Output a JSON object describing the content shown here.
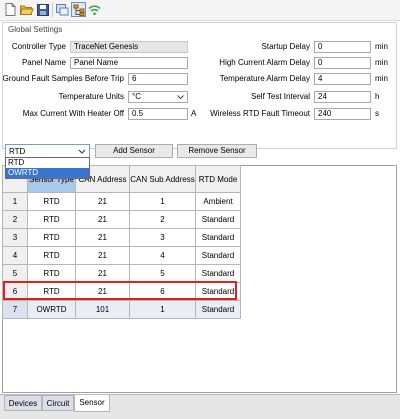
{
  "toolbar": {
    "icons": [
      "new-file-icon",
      "open-folder-icon",
      "save-icon",
      "connect-icon",
      "network-tree-icon",
      "wireless-icon"
    ]
  },
  "settings": {
    "group_title": "Global Settings",
    "controller_type": {
      "label": "Controller Type",
      "value": "TraceNet Genesis"
    },
    "panel_name": {
      "label": "Panel Name",
      "value": "Panel Name"
    },
    "ground_fault": {
      "label": "Ground Fault Samples Before Trip",
      "value": "6"
    },
    "temperature_units": {
      "label": "Temperature Units",
      "value": "°C"
    },
    "max_current": {
      "label": "Max Current With Heater Off",
      "value": "0.5",
      "unit": "A"
    },
    "startup_delay": {
      "label": "Startup Delay",
      "value": "0",
      "unit": "min"
    },
    "high_current_alarm_delay": {
      "label": "High Current Alarm Delay",
      "value": "0",
      "unit": "min"
    },
    "temperature_alarm_delay": {
      "label": "Temperature Alarm Delay",
      "value": "4",
      "unit": "min"
    },
    "self_test_interval": {
      "label": "Self Test Interval",
      "value": "24",
      "unit": "h"
    },
    "wireless_rtd_fault_timeout": {
      "label": "Wireless RTD Fault Timeout",
      "value": "240",
      "unit": "s"
    }
  },
  "sensor_controls": {
    "type_select": {
      "value": "RTD",
      "options": [
        "RTD",
        "OWRTD"
      ],
      "highlighted": "OWRTD"
    },
    "add_label": "Add Sensor",
    "remove_label": "Remove Sensor"
  },
  "table": {
    "columns": [
      "Sensor Type",
      "CAN Address",
      "CAN Sub Address",
      "RTD Mode"
    ],
    "rows": [
      {
        "num": "1",
        "type": "RTD",
        "can": "21",
        "sub": "1",
        "mode": "Ambient"
      },
      {
        "num": "2",
        "type": "RTD",
        "can": "21",
        "sub": "2",
        "mode": "Standard"
      },
      {
        "num": "3",
        "type": "RTD",
        "can": "21",
        "sub": "3",
        "mode": "Standard"
      },
      {
        "num": "4",
        "type": "RTD",
        "can": "21",
        "sub": "4",
        "mode": "Standard"
      },
      {
        "num": "5",
        "type": "RTD",
        "can": "21",
        "sub": "5",
        "mode": "Standard"
      },
      {
        "num": "6",
        "type": "RTD",
        "can": "21",
        "sub": "6",
        "mode": "Standard"
      },
      {
        "num": "7",
        "type": "OWRTD",
        "can": "101",
        "sub": "1",
        "mode": "Standard"
      }
    ]
  },
  "tabs": [
    "Devices",
    "Circuit",
    "Sensor"
  ],
  "active_tab": "Sensor",
  "colors": {
    "highlight_border": "#e02020",
    "selection": "#3a75d0"
  }
}
